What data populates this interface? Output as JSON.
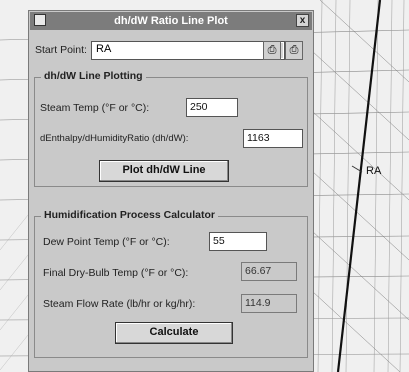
{
  "window": {
    "title": "dh/dW Ratio Line Plot",
    "close_glyph": "x"
  },
  "start_point": {
    "label": "Start Point:",
    "value": "RA"
  },
  "toolbar": {
    "print_icon": "printer-icon",
    "copy_icon": "printer-setup-icon"
  },
  "line_plotting": {
    "group_title": "dh/dW Line Plotting",
    "steam_temp_label": "Steam Temp (°F or °C):",
    "steam_temp_value": "250",
    "ratio_label": "dEnthalpy/dHumidityRatio (dh/dW):",
    "ratio_value": "1163",
    "plot_button": "Plot dh/dW Line"
  },
  "humidification": {
    "group_title": "Humidification Process Calculator",
    "dew_point_label": "Dew Point Temp (°F or °C):",
    "dew_point_value": "55",
    "final_dry_bulb_label": "Final Dry-Bulb Temp (°F or °C):",
    "final_dry_bulb_value": "66.67",
    "steam_flow_label": "Steam Flow Rate (lb/hr or kg/hr):",
    "steam_flow_value": "114.9",
    "calculate_button": "Calculate"
  },
  "chart": {
    "point_label": "RA"
  }
}
